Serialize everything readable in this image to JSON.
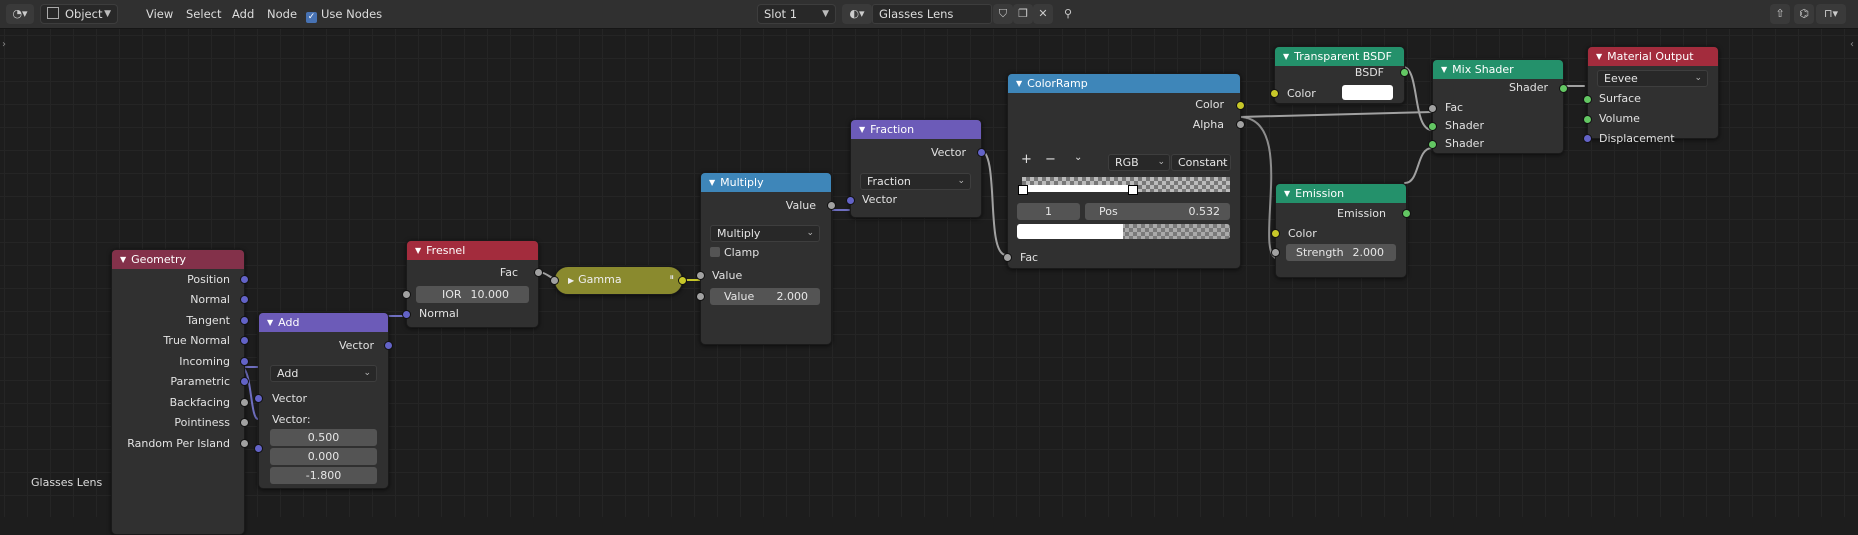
{
  "header": {
    "editor_icon": "node-editor-icon",
    "mode": "Object",
    "menu": [
      "View",
      "Select",
      "Add",
      "Node"
    ],
    "use_nodes_label": "Use Nodes",
    "use_nodes_checked": true,
    "slot": "Slot 1",
    "material_name": "Glasses Lens"
  },
  "canvas": {
    "material_label": "Glasses Lens"
  },
  "nodes": {
    "geometry": {
      "title": "Geometry",
      "outputs": [
        "Position",
        "Normal",
        "Tangent",
        "True Normal",
        "Incoming",
        "Parametric",
        "Backfacing",
        "Pointiness",
        "Random Per Island"
      ]
    },
    "add": {
      "title": "Add",
      "output": "Vector",
      "operation": "Add",
      "input": "Vector",
      "vector_label": "Vector:",
      "values": [
        "0.500",
        "0.000",
        "-1.800"
      ]
    },
    "fresnel": {
      "title": "Fresnel",
      "output": "Fac",
      "ior_label": "IOR",
      "ior_value": "10.000",
      "input": "Normal"
    },
    "gamma": {
      "title": "Gamma"
    },
    "multiply": {
      "title": "Multiply",
      "output": "Value",
      "operation": "Multiply",
      "clamp_label": "Clamp",
      "input": "Value",
      "value_label": "Value",
      "value": "2.000"
    },
    "fraction": {
      "title": "Fraction",
      "output": "Vector",
      "operation": "Fraction",
      "input": "Vector"
    },
    "colorramp": {
      "title": "ColorRamp",
      "out_color": "Color",
      "out_alpha": "Alpha",
      "color_mode": "RGB",
      "interpolation": "Constant",
      "index": "1",
      "pos_label": "Pos",
      "pos_value": "0.532",
      "input": "Fac"
    },
    "transparent": {
      "title": "Transparent BSDF",
      "output": "BSDF",
      "color_label": "Color",
      "color": "#ffffff"
    },
    "emission": {
      "title": "Emission",
      "output": "Emission",
      "color_label": "Color",
      "strength_label": "Strength",
      "strength_value": "2.000"
    },
    "mix": {
      "title": "Mix Shader",
      "output": "Shader",
      "inputs": [
        "Fac",
        "Shader",
        "Shader"
      ]
    },
    "output": {
      "title": "Material Output",
      "target": "Eevee",
      "inputs": [
        "Surface",
        "Volume",
        "Displacement"
      ]
    }
  },
  "colors": {
    "input_header": "#83314a",
    "vector_header": "#6c5bb8",
    "shader_header": "#24916b",
    "converter_header": "#3e86b9",
    "output_header": "#a32c3d",
    "gamma": "#8a8a2e"
  }
}
